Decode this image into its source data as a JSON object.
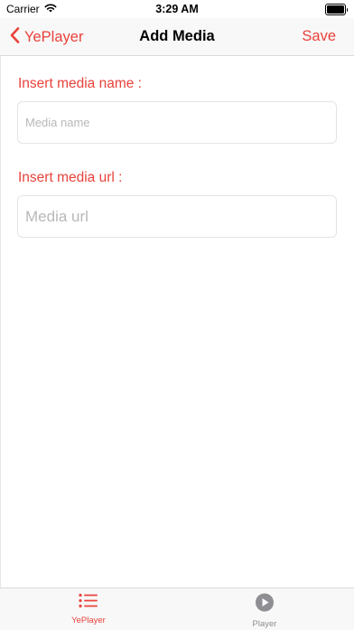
{
  "status_bar": {
    "carrier": "Carrier",
    "time": "3:29 AM"
  },
  "nav": {
    "back_label": "YePlayer",
    "title": "Add Media",
    "save_label": "Save"
  },
  "form": {
    "name_label": "Insert media name :",
    "name_placeholder": "Media name",
    "name_value": "",
    "url_label": "Insert media url :",
    "url_placeholder": "Media url",
    "url_value": ""
  },
  "tabs": [
    {
      "label": "YePlayer",
      "icon": "list-icon",
      "active": true
    },
    {
      "label": "Player",
      "icon": "play-circle-icon",
      "active": false
    }
  ],
  "colors": {
    "accent": "#e8423a",
    "inactive": "#8e8e93"
  }
}
